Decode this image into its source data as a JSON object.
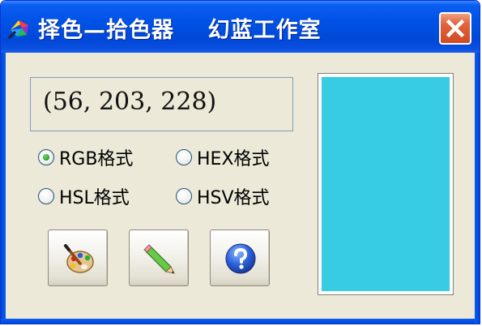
{
  "window": {
    "title": "择色—拾色器    幻蓝工作室",
    "title_icon": "color-picker-icon",
    "close_icon": "close-icon"
  },
  "color_value": "(56, 203, 228)",
  "swatch_color": "#38cbe4",
  "formats": [
    {
      "label": "RGB格式",
      "checked": true
    },
    {
      "label": "HEX格式",
      "checked": false
    },
    {
      "label": "HSL格式",
      "checked": false
    },
    {
      "label": "HSV格式",
      "checked": false
    }
  ],
  "tools": [
    {
      "icon": "palette-icon"
    },
    {
      "icon": "pencil-icon"
    },
    {
      "icon": "help-icon"
    }
  ]
}
